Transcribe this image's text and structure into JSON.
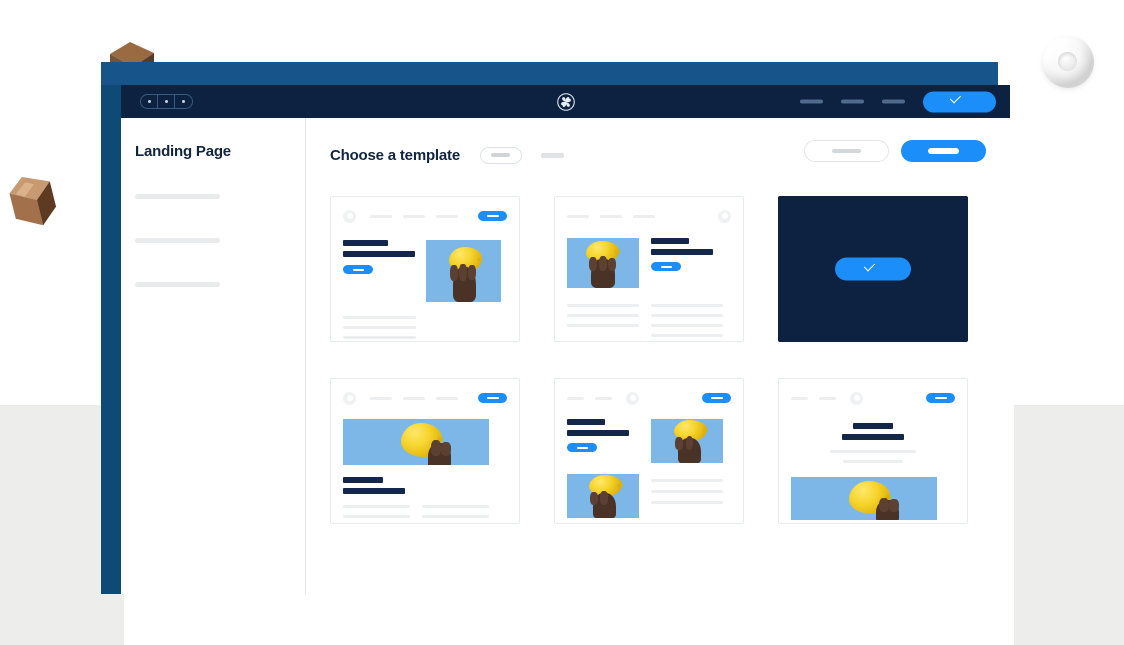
{
  "window": {
    "dots_icon": "window-controls-icon",
    "logo_icon": "spiral-logo-icon",
    "nav_placeholders": [
      "",
      "",
      ""
    ],
    "primary_action": {
      "icon": "check-icon",
      "label": ""
    }
  },
  "sidebar": {
    "title": "Landing Page",
    "items": [
      {
        "label": ""
      },
      {
        "label": ""
      },
      {
        "label": ""
      }
    ]
  },
  "content": {
    "title": "Choose a template",
    "pill_placeholder": "",
    "flat_placeholder": "",
    "actions": {
      "secondary_label": "",
      "primary_label": ""
    }
  },
  "templates": [
    {
      "id": "template-1",
      "layout": "split-text-left",
      "selected": false,
      "logo_position": "left",
      "nav_links": 3,
      "has_cta": true
    },
    {
      "id": "template-2",
      "layout": "split-image-left",
      "selected": false,
      "logo_position": "right",
      "nav_links": 3,
      "has_cta": true
    },
    {
      "id": "template-3",
      "layout": "selected",
      "selected": true,
      "select_icon": "check-icon"
    },
    {
      "id": "template-4",
      "layout": "hero-full-width",
      "selected": false,
      "logo_position": "left",
      "nav_links": 3,
      "has_cta": false
    },
    {
      "id": "template-5",
      "layout": "zigzag",
      "selected": false,
      "logo_position": "center",
      "nav_links": 2,
      "has_cta": true
    },
    {
      "id": "template-6",
      "layout": "centered-hero",
      "selected": false,
      "logo_position": "center",
      "nav_links": 2,
      "has_cta": false
    }
  ],
  "decor": [
    {
      "name": "cube-prop-top",
      "icon": "wooden-cube-icon"
    },
    {
      "name": "cube-prop-left",
      "icon": "cardboard-box-icon"
    },
    {
      "name": "sphere-prop",
      "icon": "glossy-sphere-icon"
    }
  ],
  "colors": {
    "brand_blue": "#1c8ef9",
    "navy": "#0d2240",
    "rail_blue": "#0d4a75",
    "topbar_upper": "#17548a",
    "band_gray": "#ededeb",
    "photo_bg": "#7db7e8"
  }
}
